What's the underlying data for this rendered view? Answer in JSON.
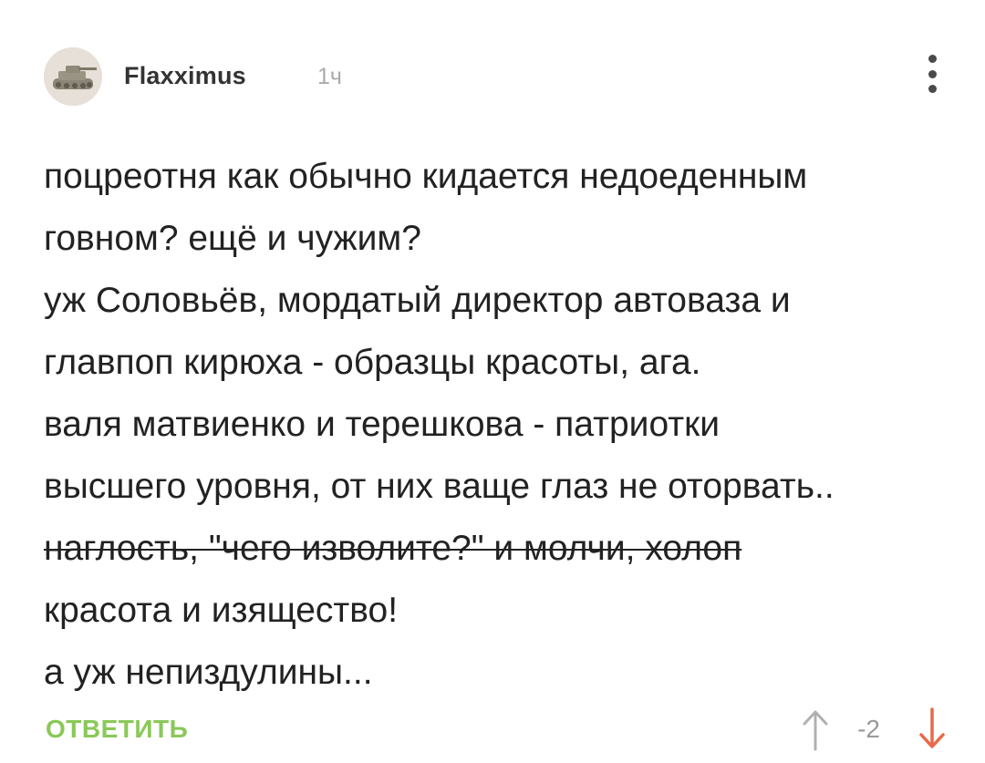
{
  "comment": {
    "author": "Flaxximus",
    "time": "1ч",
    "lines": [
      "поцреотня как обычно кидается недоеденным",
      "говном? ещё и чужим?",
      "уж Соловьёв, мордатый директор автоваза и",
      "главпоп кирюха - образцы красоты, ага.",
      "валя матвиенко и терешкова - патриотки",
      "высшего уровня, от них ваще глаз не оторвать..",
      "наглость, \"чего изволите?\" и молчи, холоп",
      "красота и изящество!",
      "а уж непиздулины..."
    ],
    "strikethrough_line_index": 6
  },
  "footer": {
    "reply_label": "ОТВЕТИТЬ",
    "score": "-2"
  },
  "colors": {
    "reply": "#8ac858",
    "downvote": "#e86a4a",
    "upvote": "#b0b0b0"
  },
  "icons": {
    "menu": "more-vertical-icon",
    "upvote": "arrow-up-icon",
    "downvote": "arrow-down-icon"
  }
}
